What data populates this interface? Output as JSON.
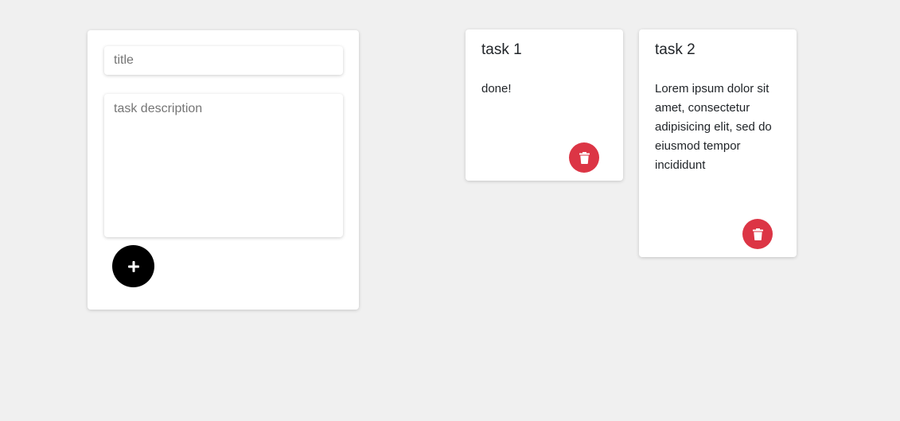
{
  "form": {
    "title_placeholder": "title",
    "description_placeholder": "task description",
    "add_icon": "plus-icon"
  },
  "notes": [
    {
      "title": "task 1",
      "content": "done!",
      "delete_icon": "trash-icon"
    },
    {
      "title": "task 2",
      "content": "Lorem ipsum dolor sit amet, consectetur adipisicing elit, sed do eiusmod tempor incididunt",
      "delete_icon": "trash-icon"
    }
  ],
  "colors": {
    "background": "#f0f0f0",
    "card": "#ffffff",
    "add_button": "#000000",
    "delete_button": "#dc3545"
  }
}
